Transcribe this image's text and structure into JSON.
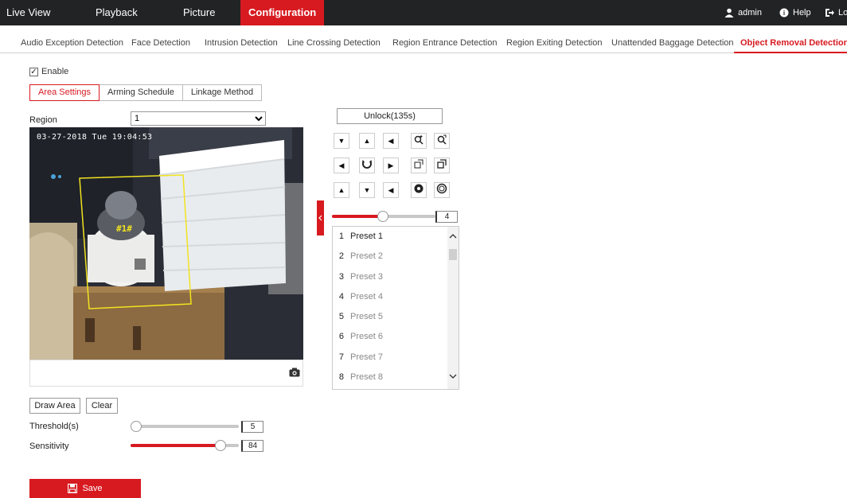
{
  "topnav": {
    "items": [
      "Live View",
      "Playback",
      "Picture",
      "Configuration"
    ],
    "active": "Configuration",
    "user": "admin",
    "help": "Help",
    "logout": "Lo"
  },
  "subtabs": [
    "Audio Exception Detection",
    "Face Detection",
    "Intrusion Detection",
    "Line Crossing Detection",
    "Region Entrance Detection",
    "Region Exiting Detection",
    "Unattended Baggage Detection",
    "Object Removal Detection"
  ],
  "active_subtab": "Object Removal Detection",
  "enable": {
    "label": "Enable",
    "checked": true
  },
  "steps": [
    "Area Settings",
    "Arming Schedule",
    "Linkage Method"
  ],
  "region": {
    "label": "Region",
    "value": "1"
  },
  "video": {
    "timestamp": "03-27-2018 Tue 19:04:53",
    "region_tag": "#1#"
  },
  "ptz": {
    "unlock_label": "Unlock(135s)",
    "speed": "4"
  },
  "presets": [
    {
      "num": "1",
      "name": "Preset 1"
    },
    {
      "num": "2",
      "name": "Preset 2"
    },
    {
      "num": "3",
      "name": "Preset 3"
    },
    {
      "num": "4",
      "name": "Preset 4"
    },
    {
      "num": "5",
      "name": "Preset 5"
    },
    {
      "num": "6",
      "name": "Preset 6"
    },
    {
      "num": "7",
      "name": "Preset 7"
    },
    {
      "num": "8",
      "name": "Preset 8"
    }
  ],
  "draw_area": "Draw Area",
  "clear": "Clear",
  "threshold": {
    "label": "Threshold(s)",
    "value": "5"
  },
  "sensitivity": {
    "label": "Sensitivity",
    "value": "84"
  },
  "save": "Save",
  "colors": {
    "accent": "#d71a20",
    "topbar": "#222325"
  },
  "icons": [
    "user-icon",
    "help-icon",
    "logout-icon",
    "camera-icon",
    "save-icon",
    "collapse-arrow-icon",
    "scroll-up-icon",
    "scroll-down-icon",
    "zoom-in-icon",
    "zoom-out-icon",
    "focus-near-icon",
    "focus-far-icon",
    "iris-open-icon",
    "iris-close-icon",
    "auto-pan-icon"
  ]
}
